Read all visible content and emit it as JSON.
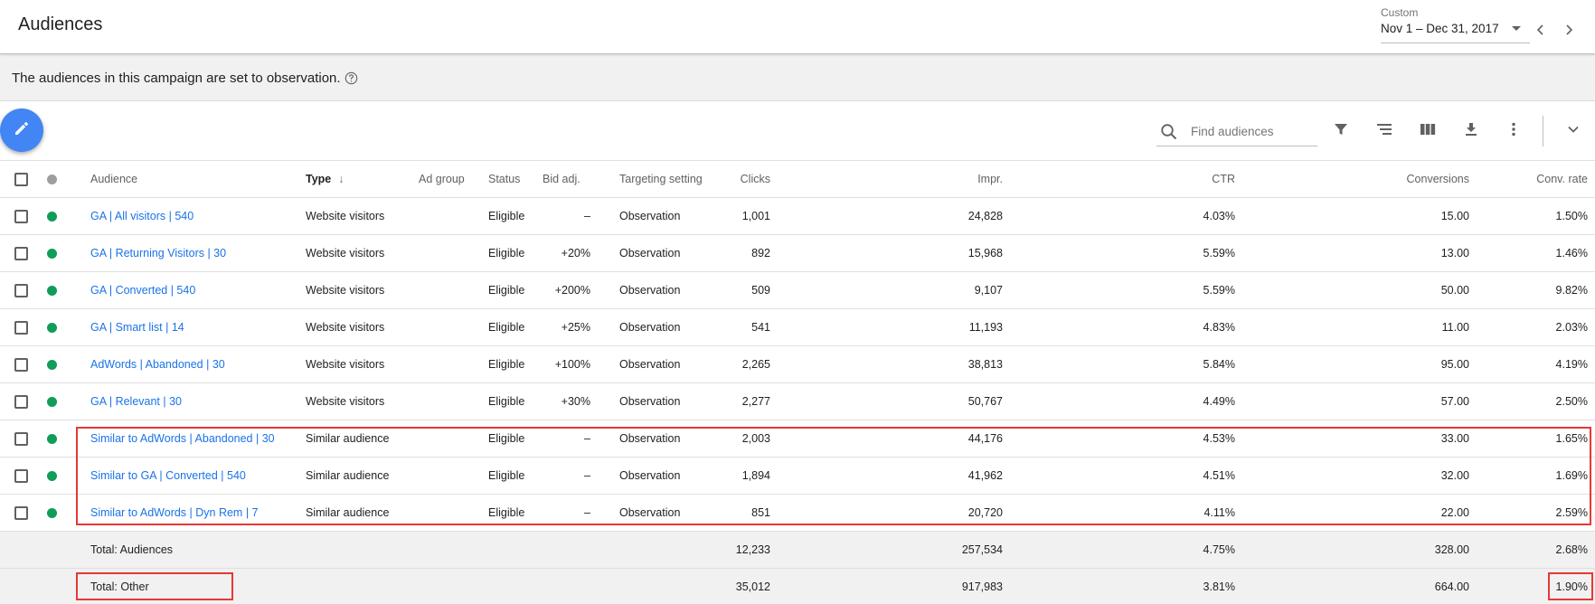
{
  "header": {
    "title": "Audiences",
    "date_label": "Custom",
    "date_range": "Nov 1 – Dec 31, 2017"
  },
  "banner": {
    "text": "The audiences in this campaign are set to observation."
  },
  "toolbar": {
    "search_placeholder": "Find audiences"
  },
  "table": {
    "columns": {
      "audience": "Audience",
      "type": "Type",
      "ad_group": "Ad group",
      "status": "Status",
      "bid_adj": "Bid adj.",
      "targeting": "Targeting setting",
      "clicks": "Clicks",
      "impr": "Impr.",
      "ctr": "CTR",
      "conversions": "Conversions",
      "conv_rate": "Conv. rate"
    },
    "sorted_column": "type",
    "rows": [
      {
        "audience": "GA | All visitors | 540",
        "type": "Website visitors",
        "ad_group": "",
        "status": "Eligible",
        "bid_adj": "–",
        "targeting": "Observation",
        "clicks": "1,001",
        "impr": "24,828",
        "ctr": "4.03%",
        "conversions": "15.00",
        "conv_rate": "1.50%"
      },
      {
        "audience": "GA | Returning Visitors | 30",
        "type": "Website visitors",
        "ad_group": "",
        "status": "Eligible",
        "bid_adj": "+20%",
        "targeting": "Observation",
        "clicks": "892",
        "impr": "15,968",
        "ctr": "5.59%",
        "conversions": "13.00",
        "conv_rate": "1.46%"
      },
      {
        "audience": "GA | Converted | 540",
        "type": "Website visitors",
        "ad_group": "",
        "status": "Eligible",
        "bid_adj": "+200%",
        "targeting": "Observation",
        "clicks": "509",
        "impr": "9,107",
        "ctr": "5.59%",
        "conversions": "50.00",
        "conv_rate": "9.82%"
      },
      {
        "audience": "GA | Smart list | 14",
        "type": "Website visitors",
        "ad_group": "",
        "status": "Eligible",
        "bid_adj": "+25%",
        "targeting": "Observation",
        "clicks": "541",
        "impr": "11,193",
        "ctr": "4.83%",
        "conversions": "11.00",
        "conv_rate": "2.03%"
      },
      {
        "audience": "AdWords | Abandoned | 30",
        "type": "Website visitors",
        "ad_group": "",
        "status": "Eligible",
        "bid_adj": "+100%",
        "targeting": "Observation",
        "clicks": "2,265",
        "impr": "38,813",
        "ctr": "5.84%",
        "conversions": "95.00",
        "conv_rate": "4.19%"
      },
      {
        "audience": "GA | Relevant | 30",
        "type": "Website visitors",
        "ad_group": "",
        "status": "Eligible",
        "bid_adj": "+30%",
        "targeting": "Observation",
        "clicks": "2,277",
        "impr": "50,767",
        "ctr": "4.49%",
        "conversions": "57.00",
        "conv_rate": "2.50%"
      },
      {
        "audience": "Similar to AdWords | Abandoned | 30",
        "type": "Similar audience",
        "ad_group": "",
        "status": "Eligible",
        "bid_adj": "–",
        "targeting": "Observation",
        "clicks": "2,003",
        "impr": "44,176",
        "ctr": "4.53%",
        "conversions": "33.00",
        "conv_rate": "1.65%"
      },
      {
        "audience": "Similar to GA | Converted | 540",
        "type": "Similar audience",
        "ad_group": "",
        "status": "Eligible",
        "bid_adj": "–",
        "targeting": "Observation",
        "clicks": "1,894",
        "impr": "41,962",
        "ctr": "4.51%",
        "conversions": "32.00",
        "conv_rate": "1.69%"
      },
      {
        "audience": "Similar to AdWords | Dyn Rem | 7",
        "type": "Similar audience",
        "ad_group": "",
        "status": "Eligible",
        "bid_adj": "–",
        "targeting": "Observation",
        "clicks": "851",
        "impr": "20,720",
        "ctr": "4.11%",
        "conversions": "22.00",
        "conv_rate": "2.59%"
      }
    ],
    "totals": [
      {
        "label": "Total: Audiences",
        "clicks": "12,233",
        "impr": "257,534",
        "ctr": "4.75%",
        "conversions": "328.00",
        "conv_rate": "2.68%"
      },
      {
        "label": "Total: Other",
        "clicks": "35,012",
        "impr": "917,983",
        "ctr": "3.81%",
        "conversions": "664.00",
        "conv_rate": "1.90%"
      }
    ]
  },
  "colors": {
    "link": "#1a73e8",
    "status_enabled": "#0f9d58",
    "fab": "#4285f4",
    "highlight": "#e53935"
  },
  "icons": {
    "fab": "pencil-icon",
    "help": "help-circle-icon",
    "search": "search-icon",
    "filter": "filter-icon",
    "segment": "segment-icon",
    "columns": "columns-icon",
    "download": "download-icon",
    "more": "more-vert-icon",
    "collapse": "chevron-down-icon"
  }
}
